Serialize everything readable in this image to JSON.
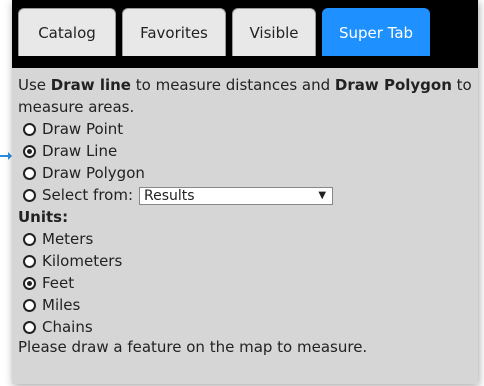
{
  "tabs": [
    {
      "label": "Catalog",
      "active": false
    },
    {
      "label": "Favorites",
      "active": false
    },
    {
      "label": "Visible",
      "active": false
    },
    {
      "label": "Super Tab",
      "active": true
    }
  ],
  "intro": {
    "part1": "Use ",
    "bold1": "Draw line",
    "part2": " to measure distances and ",
    "bold2": "Draw Polygon",
    "part3": " to measure areas."
  },
  "draw_options": [
    {
      "label": "Draw Point",
      "checked": false
    },
    {
      "label": "Draw Line",
      "checked": true
    },
    {
      "label": "Draw Polygon",
      "checked": false
    }
  ],
  "select_from": {
    "label": "Select from:",
    "value": "Results"
  },
  "units": {
    "heading": "Units:",
    "options": [
      {
        "label": "Meters",
        "checked": false
      },
      {
        "label": "Kilometers",
        "checked": false
      },
      {
        "label": "Feet",
        "checked": true
      },
      {
        "label": "Miles",
        "checked": false
      },
      {
        "label": "Chains",
        "checked": false
      }
    ]
  },
  "status_message": "Please draw a feature on the map to measure.",
  "colors": {
    "active_tab": "#1e90ff",
    "panel_bg": "#d6d6d6",
    "tab_bar": "#000000"
  }
}
